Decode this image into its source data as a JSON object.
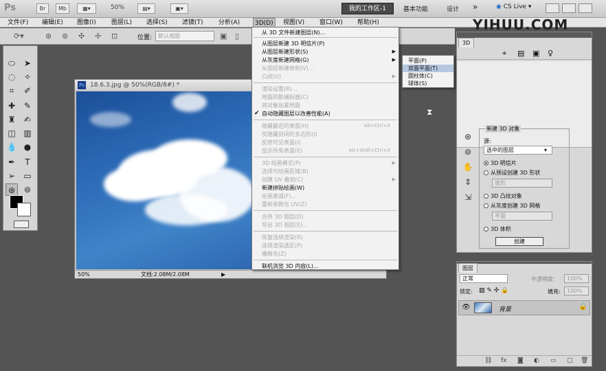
{
  "appbar": {
    "ps_logo": "Ps",
    "zoom": "50%",
    "workspace": "我的工作区-1",
    "basic": "基本功能",
    "design": "设计",
    "more": "»",
    "cslive": "CS Live"
  },
  "menubar": [
    "文件(F)",
    "编辑(E)",
    "图像(I)",
    "图层(L)",
    "选择(S)",
    "滤镜(T)",
    "分析(A)",
    "3D(D)",
    "视图(V)",
    "窗口(W)",
    "帮助(H)"
  ],
  "options": {
    "position_label": "位置:",
    "position_value": "默认视图"
  },
  "watermark": "YIHUU.COM",
  "document": {
    "title": "18.6.3.jpg @ 50%(RGB/8#) *",
    "zoom": "50%",
    "docsize": "文档:2.08M/2.08M"
  },
  "menu3d": [
    {
      "label": "从 3D 文件新建图层(N)...",
      "state": "enabled"
    },
    {
      "label": "从图层新建 3D 明信片(P)",
      "state": "enabled"
    },
    {
      "label": "从图层新建形状(S)",
      "state": "enabled",
      "arrow": true
    },
    {
      "label": "从灰度新建网格(G)",
      "state": "enabled",
      "arrow": true
    },
    {
      "label": "从图层新建体积(V)...",
      "state": "disabled"
    },
    {
      "label": "凸纹(U)",
      "state": "disabled",
      "arrow": true
    },
    {
      "label": "渲染设置(R)...",
      "state": "disabled"
    },
    {
      "label": "地面阴影捕捉器(C)",
      "state": "disabled"
    },
    {
      "label": "将对象贴紧地面",
      "state": "disabled"
    },
    {
      "label": "自动隐藏图层以改善性能(A)",
      "state": "checked"
    },
    {
      "label": "隐藏最近的表面(H)",
      "state": "disabled",
      "shortcut": "Alt+Ctrl+X"
    },
    {
      "label": "仅隐藏封闭的多边形(I)",
      "state": "disabled"
    },
    {
      "label": "反转可见表面(I)",
      "state": "disabled"
    },
    {
      "label": "显示所有表面(E)",
      "state": "disabled",
      "shortcut": "Alt+Shift+Ctrl+X"
    },
    {
      "label": "3D 绘画模式(P)",
      "state": "disabled",
      "arrow": true
    },
    {
      "label": "选择可绘画区域(B)",
      "state": "disabled"
    },
    {
      "label": "创建 UV 叠加(C)",
      "state": "disabled",
      "arrow": true
    },
    {
      "label": "新建拼贴绘画(W)",
      "state": "enabled"
    },
    {
      "label": "绘画衰减(F)...",
      "state": "disabled"
    },
    {
      "label": "重新参数化 UV(Z)",
      "state": "disabled"
    },
    {
      "label": "合并 3D 图层(D)",
      "state": "disabled"
    },
    {
      "label": "导出 3D 图层(E)...",
      "state": "disabled"
    },
    {
      "label": "恢复连续渲染(R)",
      "state": "disabled"
    },
    {
      "label": "连续渲染选区(P)",
      "state": "disabled"
    },
    {
      "label": "栅格化(Z)",
      "state": "disabled"
    },
    {
      "label": "联机浏览 3D 内容(L)...",
      "state": "enabled"
    }
  ],
  "submenu": [
    {
      "label": "平面(P)",
      "hl": false
    },
    {
      "label": "双面平面(T)",
      "hl": true
    },
    {
      "label": "圆柱体(C)",
      "hl": false
    },
    {
      "label": "球体(S)",
      "hl": false
    }
  ],
  "panel3d": {
    "tab": "3D",
    "group_title": "新建 3D 对象",
    "source_label": "源:",
    "source_value": "选中的图层",
    "create_button": "创建",
    "options": [
      "3D 明信片",
      "从预设创建 3D 形状",
      "3D 凸纹对象",
      "从灰度创建 3D 网格",
      "3D 体积"
    ],
    "shape_dropdown": "锥形",
    "mesh_dropdown": "平面"
  },
  "layers": {
    "tab": "图层",
    "blend": "正常",
    "opacity_label": "不透明度:",
    "opacity": "100%",
    "lock_label": "锁定:",
    "fill_label": "填充:",
    "fill": "100%",
    "layer_name": "背景"
  }
}
